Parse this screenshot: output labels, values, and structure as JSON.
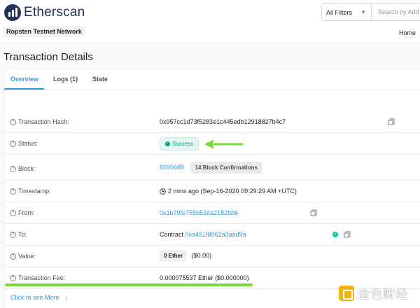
{
  "header": {
    "brand": "Etherscan",
    "network": "Ropsten Testnet Network",
    "filter_label": "All Filters",
    "search_placeholder": "Search by Add",
    "home": "Home"
  },
  "page_title": "Transaction Details",
  "tabs": [
    {
      "label": "Overview",
      "active": true
    },
    {
      "label": "Logs (1)",
      "active": false
    },
    {
      "label": "State",
      "active": false
    }
  ],
  "details": {
    "hash_label": "Transaction Hash:",
    "hash_value": "0x957cc1d73f5283e1c445edb12918827b4c7",
    "status_label": "Status:",
    "status_value": "Success",
    "block_label": "Block:",
    "block_value": "8695688",
    "block_confirmations": "14 Block Confirmations",
    "timestamp_label": "Timestamp:",
    "timestamp_value": "2 mins ago (Sep-16-2020 09:29:29 AM +UTC)",
    "from_label": "From:",
    "from_value": "0x1b79fe755b53ea2182bb6",
    "to_label": "To:",
    "to_prefix": "Contract",
    "to_value": "0xa451f8062a3aad9a",
    "value_label": "Value:",
    "value_amount": "0 Ether",
    "value_usd": "($0.00)",
    "fee_label": "Transaction Fee:",
    "fee_value": "0.000075537 Ether ($0.000000)"
  },
  "see_more": "Click to see More",
  "watermark": "金色财经",
  "colors": {
    "accent": "#3498db",
    "success": "#00a186",
    "annotation": "#79d93a",
    "brand": "#21325b"
  }
}
